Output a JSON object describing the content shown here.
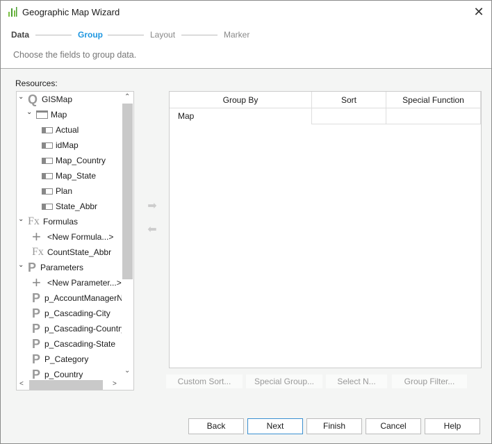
{
  "window": {
    "title": "Geographic Map Wizard",
    "close_icon": "close-icon",
    "app_icon": "bar-chart-icon"
  },
  "steps": [
    {
      "label": "Data",
      "state": "done"
    },
    {
      "label": "Group",
      "state": "active"
    },
    {
      "label": "Layout",
      "state": "pending"
    },
    {
      "label": "Marker",
      "state": "pending"
    }
  ],
  "hint": "Choose the fields to group data.",
  "resources": {
    "label": "Resources:",
    "items": [
      {
        "label": "GISMap",
        "icon": "query-icon",
        "level": 0,
        "expanded": true
      },
      {
        "label": "Map",
        "icon": "table-icon",
        "level": 1,
        "expanded": true
      },
      {
        "label": "Actual",
        "icon": "field-icon",
        "level": 2
      },
      {
        "label": "idMap",
        "icon": "field-icon",
        "level": 2
      },
      {
        "label": "Map_Country",
        "icon": "field-icon",
        "level": 2
      },
      {
        "label": "Map_State",
        "icon": "field-icon",
        "level": 2
      },
      {
        "label": "Plan",
        "icon": "field-icon",
        "level": 2
      },
      {
        "label": "State_Abbr",
        "icon": "field-icon",
        "level": 2
      },
      {
        "label": "Formulas",
        "icon": "formula-icon",
        "level": 0,
        "expanded": true
      },
      {
        "label": "<New Formula...>",
        "icon": "plus-icon",
        "level": 1
      },
      {
        "label": "CountState_Abbr",
        "icon": "formula-icon",
        "level": 1
      },
      {
        "label": "Parameters",
        "icon": "parameter-icon",
        "level": 0,
        "expanded": true
      },
      {
        "label": "<New Parameter...>",
        "icon": "plus-icon",
        "level": 1
      },
      {
        "label": "p_AccountManagerName",
        "icon": "parameter-icon",
        "level": 1
      },
      {
        "label": "p_Cascading-City",
        "icon": "parameter-icon",
        "level": 1
      },
      {
        "label": "p_Cascading-Country",
        "icon": "parameter-icon",
        "level": 1
      },
      {
        "label": "p_Cascading-State",
        "icon": "parameter-icon",
        "level": 1
      },
      {
        "label": "P_Category",
        "icon": "parameter-icon",
        "level": 1
      },
      {
        "label": "p_Country",
        "icon": "parameter-icon",
        "level": 1
      }
    ]
  },
  "grid": {
    "columns": [
      "Group By",
      "Sort",
      "Special Function"
    ],
    "rows": [
      [
        "Map",
        "",
        ""
      ]
    ]
  },
  "actions": [
    "Custom Sort...",
    "Special Group...",
    "Select N...",
    "Group Filter..."
  ],
  "buttons": {
    "back": "Back",
    "next": "Next",
    "finish": "Finish",
    "cancel": "Cancel",
    "help": "Help"
  }
}
